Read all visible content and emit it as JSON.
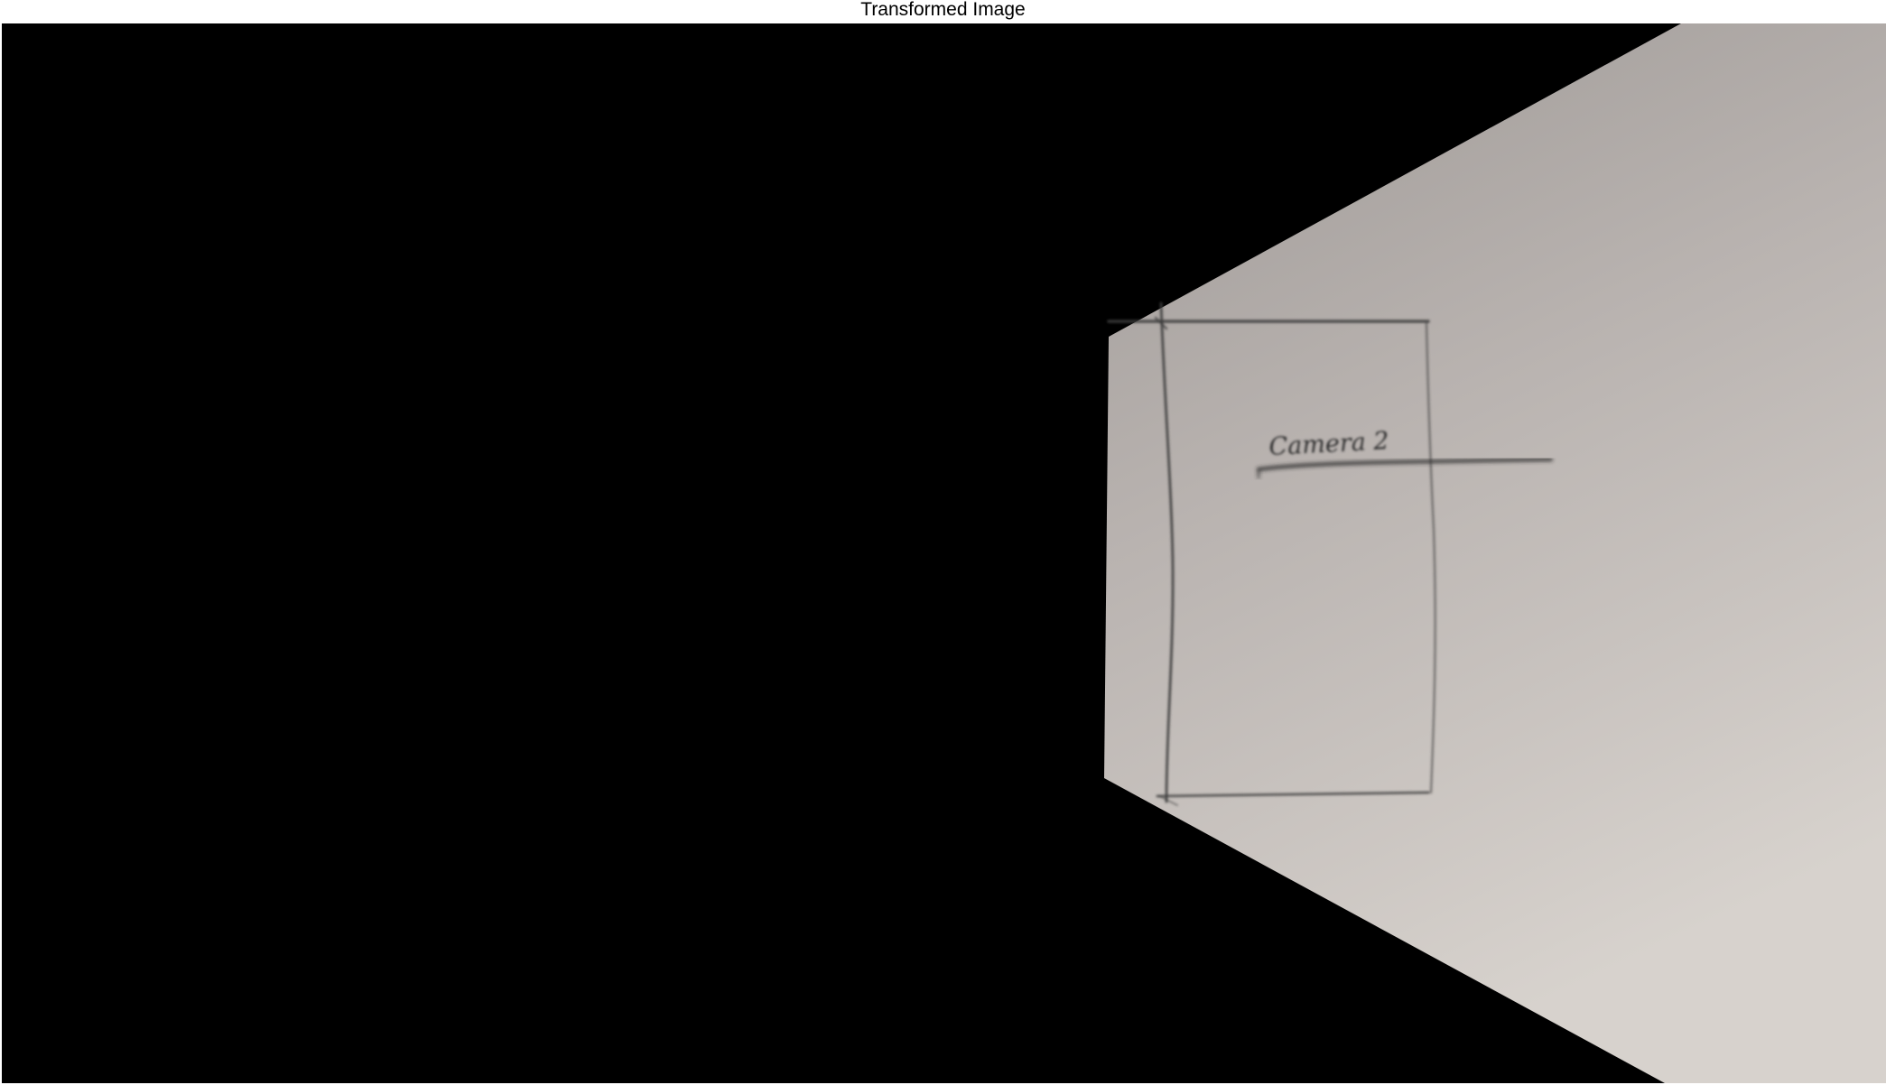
{
  "figure": {
    "title": "Transformed Image"
  },
  "image": {
    "background_color": "#000000",
    "paper_colors": [
      "#a19c9a",
      "#bcb6b3",
      "#d6d1cc"
    ],
    "pencil_color": "#3c3c3c",
    "handwritten_label": "Camera 2"
  }
}
